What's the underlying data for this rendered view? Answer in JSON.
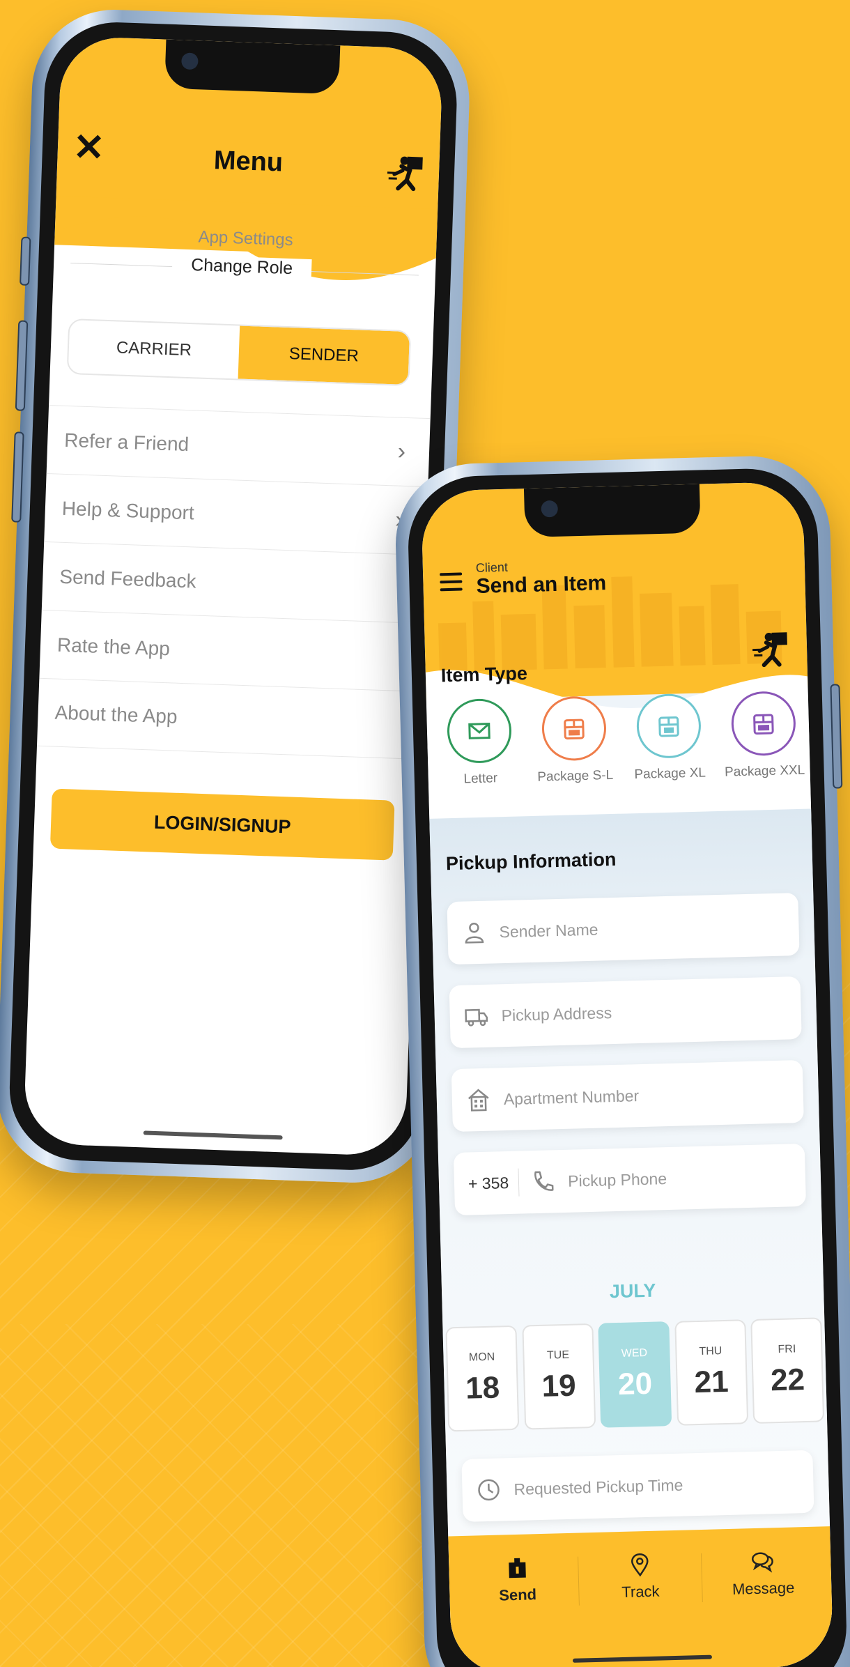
{
  "menu_screen": {
    "title": "Menu",
    "app_settings": "App Settings",
    "change_role": "Change Role",
    "roles": {
      "carrier": "CARRIER",
      "sender": "SENDER",
      "active": "sender"
    },
    "items": [
      {
        "label": "Refer a Friend",
        "chevron": "›"
      },
      {
        "label": "Help & Support",
        "chevron": "›"
      },
      {
        "label": "Send Feedback",
        "chevron": ""
      },
      {
        "label": "Rate the App",
        "chevron": ""
      },
      {
        "label": "About the App",
        "chevron": ""
      }
    ],
    "login_button": "LOGIN/SIGNUP"
  },
  "send_screen": {
    "subtitle": "Client",
    "title": "Send an Item",
    "item_type_title": "Item Type",
    "item_types": [
      {
        "label": "Letter",
        "icon": "envelope-icon",
        "color": "#2f9a5a"
      },
      {
        "label": "Package S-L",
        "icon": "package-sl-icon",
        "color": "#ef7d4a"
      },
      {
        "label": "Package XL",
        "icon": "package-xl-icon",
        "color": "#6ec6cf"
      },
      {
        "label": "Package XXL",
        "icon": "package-xxl-icon",
        "color": "#8a56b8"
      }
    ],
    "pickup_title": "Pickup Information",
    "fields": {
      "sender_name": "Sender Name",
      "pickup_address": "Pickup Address",
      "apartment_number": "Apartment Number",
      "phone_prefix": "+ 358",
      "pickup_phone": "Pickup Phone",
      "pickup_time": "Requested Pickup Time"
    },
    "month": "JULY",
    "days": [
      {
        "name": "MON",
        "num": "18"
      },
      {
        "name": "TUE",
        "num": "19"
      },
      {
        "name": "WED",
        "num": "20",
        "selected": true
      },
      {
        "name": "THU",
        "num": "21"
      },
      {
        "name": "FRI",
        "num": "22"
      }
    ],
    "tabs": [
      {
        "label": "Send",
        "icon": "package-icon",
        "active": true
      },
      {
        "label": "Track",
        "icon": "location-pin-icon"
      },
      {
        "label": "Message",
        "icon": "chat-icon"
      }
    ]
  },
  "colors": {
    "brand_yellow": "#FDBE2B",
    "accent_teal": "#6ec6cf"
  }
}
